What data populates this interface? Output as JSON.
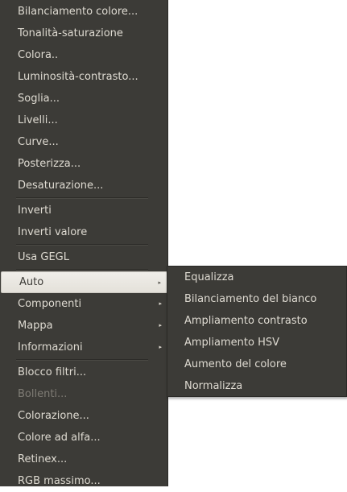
{
  "main_menu": {
    "groups": [
      {
        "items": [
          {
            "label": "Bilanciamento colore..."
          },
          {
            "label": "Tonalità-saturazione"
          },
          {
            "label": "Colora.."
          },
          {
            "label": "Luminosità-contrasto..."
          },
          {
            "label": "Soglia..."
          },
          {
            "label": "Livelli..."
          },
          {
            "label": "Curve..."
          },
          {
            "label": "Posterizza..."
          },
          {
            "label": "Desaturazione..."
          }
        ]
      },
      {
        "items": [
          {
            "label": "Inverti"
          },
          {
            "label": "Inverti valore"
          }
        ]
      },
      {
        "items": [
          {
            "label": "Usa GEGL"
          }
        ]
      },
      {
        "items": [
          {
            "label": "Auto",
            "submenu": true,
            "active": true
          },
          {
            "label": "Componenti",
            "submenu": true
          },
          {
            "label": "Mappa",
            "submenu": true
          },
          {
            "label": "Informazioni",
            "submenu": true
          }
        ]
      },
      {
        "items": [
          {
            "label": "Blocco filtri..."
          },
          {
            "label": "Bollenti...",
            "disabled": true
          },
          {
            "label": "Colorazione..."
          },
          {
            "label": "Colore ad alfa..."
          },
          {
            "label": "Retinex..."
          },
          {
            "label": "RGB massimo..."
          }
        ]
      }
    ],
    "submenu_arrow": "▸"
  },
  "auto_submenu": {
    "items": [
      {
        "label": "Equalizza"
      },
      {
        "label": "Bilanciamento del bianco"
      },
      {
        "label": "Ampliamento contrasto"
      },
      {
        "label": "Ampliamento HSV"
      },
      {
        "label": "Aumento del colore"
      },
      {
        "label": "Normalizza"
      }
    ]
  }
}
